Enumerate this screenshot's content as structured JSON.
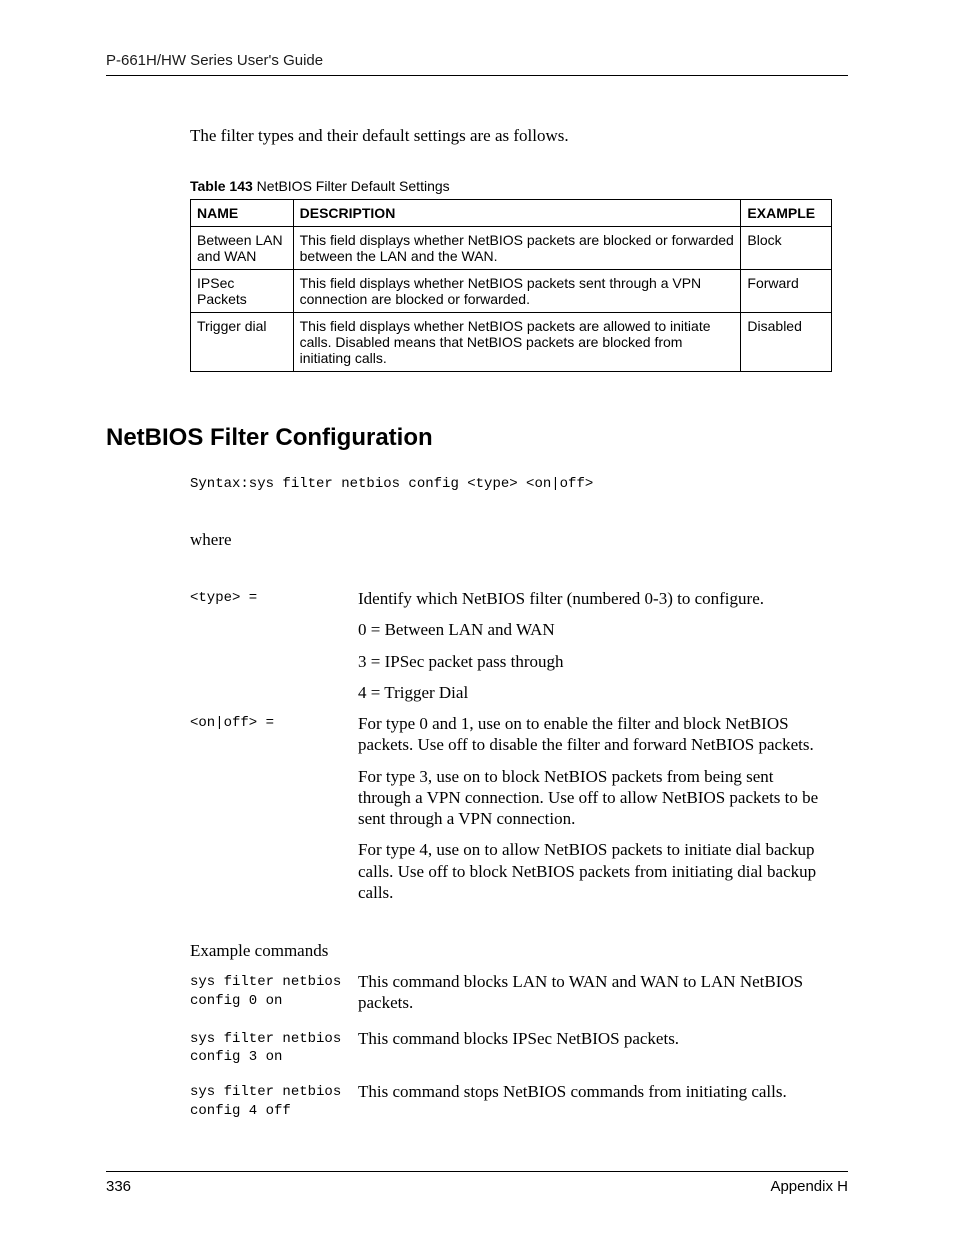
{
  "header": "P-661H/HW Series User's Guide",
  "intro": "The filter types and their default settings are as follows.",
  "table_caption_bold": "Table 143",
  "table_caption_rest": "   NetBIOS Filter Default Settings",
  "table": {
    "headers": {
      "name": "NAME",
      "desc": "DESCRIPTION",
      "example": "EXAMPLE"
    },
    "rows": [
      {
        "name": "Between LAN and WAN",
        "desc": "This field displays whether NetBIOS packets are blocked or forwarded between the LAN and the WAN.",
        "example": "Block"
      },
      {
        "name": "IPSec Packets",
        "desc": "This field displays whether NetBIOS packets sent through a VPN connection are blocked or forwarded.",
        "example": "Forward"
      },
      {
        "name": "Trigger dial",
        "desc": "This field displays whether NetBIOS packets are allowed to initiate calls. Disabled means that NetBIOS packets are blocked from initiating calls.",
        "example": "Disabled"
      }
    ]
  },
  "section_title": "NetBIOS Filter Configuration",
  "syntax": "Syntax:sys filter netbios config <type> <on|off>",
  "where": "where",
  "defs": [
    {
      "term": "<type> =",
      "paras": [
        "Identify which NetBIOS filter (numbered 0-3) to configure.",
        "0 = Between LAN and WAN",
        "3 = IPSec packet pass through",
        "4 = Trigger Dial"
      ]
    },
    {
      "term": "<on|off> =",
      "paras": [
        "For type 0 and 1, use on to enable the filter and block NetBIOS packets. Use off to disable the filter and forward NetBIOS packets.",
        "For type 3, use on to block NetBIOS packets from being sent through a VPN connection. Use off to allow NetBIOS packets to be sent through a VPN connection.",
        "For type 4, use on to allow NetBIOS packets to initiate dial backup calls. Use off to block NetBIOS packets from initiating dial backup calls."
      ]
    }
  ],
  "examples_header": "Example commands",
  "examples": [
    {
      "cmd": "sys filter netbios config 0 on",
      "desc": "This command blocks LAN to WAN and WAN to LAN NetBIOS packets."
    },
    {
      "cmd": "sys filter netbios config 3 on",
      "desc": "This command blocks IPSec NetBIOS packets."
    },
    {
      "cmd": "sys filter netbios config 4 off",
      "desc": "This command stops NetBIOS commands from initiating calls."
    }
  ],
  "footer": {
    "page": "336",
    "appendix": "Appendix H"
  }
}
